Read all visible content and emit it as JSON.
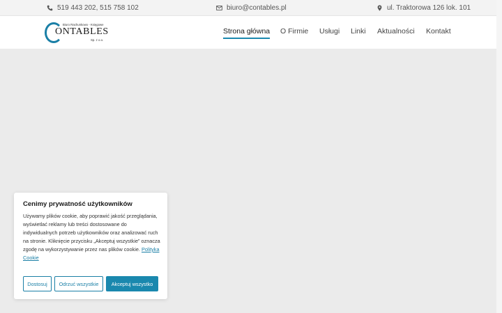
{
  "topbar": {
    "phone": "519 443 202, 515 758 102",
    "email": "biuro@contables.pl",
    "address": "ul. Traktorowa 126 lok. 101",
    "icons": [
      "phone-icon",
      "mail-icon",
      "map-pin-icon"
    ]
  },
  "logo": {
    "top_line": "Biuro Rachunkowo - Księgowe",
    "word": "ONTABLES",
    "suffix": "Sp. z o.o."
  },
  "nav": {
    "items": [
      {
        "label": "Strona główna",
        "active": true
      },
      {
        "label": "O Firmie"
      },
      {
        "label": "Usługi"
      },
      {
        "label": "Linki"
      },
      {
        "label": "Aktualności"
      },
      {
        "label": "Kontakt"
      }
    ]
  },
  "cookie": {
    "title": "Cenimy prywatność użytkowników",
    "body": "Używamy plików cookie, aby poprawić jakość przeglądania, wyświetlać reklamy lub treści dostosowane do indywidualnych potrzeb użytkowników oraz analizować ruch na stronie. Kliknięcie przycisku „Akceptuj wszystkie” oznacza zgodę na wykorzystywanie przez nas plików cookie.",
    "policy_link": "Polityka Cookie",
    "buttons": {
      "customize": "Dostosuj",
      "reject": "Odrzuć wszystkie",
      "accept": "Akceptuj wszystko"
    }
  },
  "colors": {
    "accent": "#1a88ae",
    "background": "#ebebeb",
    "topbar": "#f3f3f3"
  }
}
